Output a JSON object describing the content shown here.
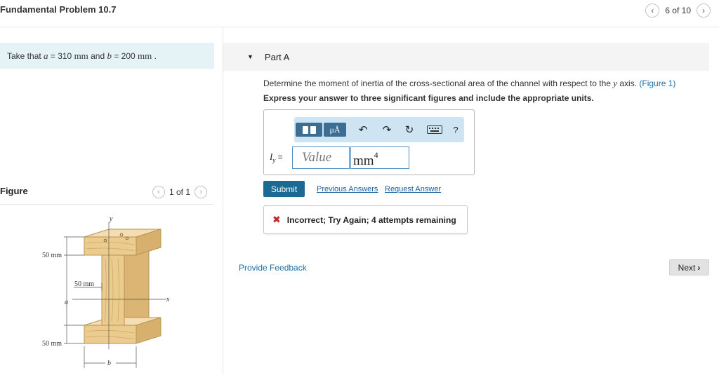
{
  "header": {
    "title": "Fundamental Problem 10.7",
    "counter": "6 of 10",
    "prev_icon": "chevron-left-icon",
    "next_icon": "chevron-right-icon"
  },
  "given": {
    "prefix": "Take that ",
    "a_sym": "a",
    "a_val": " = 310 ",
    "a_unit": "mm",
    "and": " and ",
    "b_sym": "b",
    "b_val": " = 200 ",
    "b_unit": "mm",
    "suffix": " ."
  },
  "figure": {
    "label": "Figure",
    "pager": "1 of 1",
    "dim_top": "50 mm",
    "dim_web": "50 mm",
    "dim_bottom": "50 mm",
    "label_a": "a",
    "label_b": "b",
    "label_x": "x",
    "label_y": "y"
  },
  "part": {
    "label": "Part A",
    "question_pre": "Determine the moment of inertia of the cross-sectional area of the channel with respect to the ",
    "question_axis": "y",
    "question_post": " axis. ",
    "figure_link": "(Figure 1)",
    "instructions": "Express your answer to three significant figures and include the appropriate units."
  },
  "answer": {
    "var_label": "I",
    "var_sub": "y",
    "equals": " =",
    "value_placeholder": "Value",
    "units": "mm",
    "units_exp": "4",
    "toolbar": {
      "mu_label": "μÅ",
      "undo_icon": "↶",
      "redo_icon": "↷",
      "reset_icon": "↻",
      "help_label": "?"
    }
  },
  "actions": {
    "submit": "Submit",
    "previous_answers": "Previous Answers",
    "request_answer": "Request Answer"
  },
  "feedback": {
    "icon": "✖",
    "message": "Incorrect; Try Again; 4 attempts remaining"
  },
  "footer": {
    "provide_feedback": "Provide Feedback",
    "next": "Next"
  },
  "colors": {
    "accent": "#1b6a94",
    "link": "#1a6fa8",
    "error": "#c4262e",
    "given_bg": "#e5f3f7",
    "toolbar_bg": "#cfe4f3",
    "wood": "#eccb8f"
  }
}
